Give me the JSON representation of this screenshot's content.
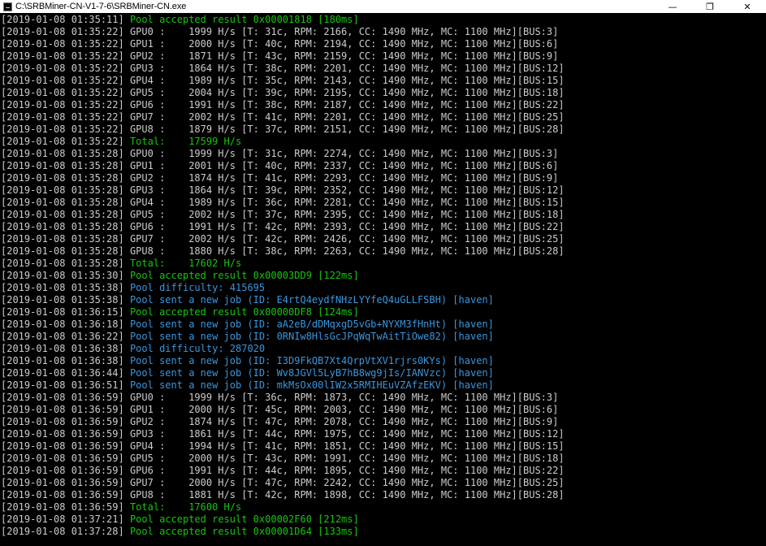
{
  "window": {
    "title": "C:\\SRBMiner-CN-V1-7-6\\SRBMiner-CN.exe",
    "minimize_glyph": "—",
    "restore_glyph": "❐",
    "close_glyph": "✕"
  },
  "colors": {
    "background": "#000000",
    "default_text": "#cccccc",
    "accepted_green": "#16c60c",
    "pool_cyan": "#3a96dd"
  },
  "console_lines": [
    {
      "text": "[2019-01-08 01:35:11] Pool accepted result 0x00001818 [180ms]",
      "style": "accepted"
    },
    {
      "text": "[2019-01-08 01:35:22] GPU0 :    1999 H/s [T: 31c, RPM: 2166, CC: 1490 MHz, MC: 1100 MHz][BUS:3]",
      "style": "normal"
    },
    {
      "text": "[2019-01-08 01:35:22] GPU1 :    2000 H/s [T: 40c, RPM: 2194, CC: 1490 MHz, MC: 1100 MHz][BUS:6]",
      "style": "normal"
    },
    {
      "text": "[2019-01-08 01:35:22] GPU2 :    1871 H/s [T: 43c, RPM: 2159, CC: 1490 MHz, MC: 1100 MHz][BUS:9]",
      "style": "normal"
    },
    {
      "text": "[2019-01-08 01:35:22] GPU3 :    1864 H/s [T: 38c, RPM: 2201, CC: 1490 MHz, MC: 1100 MHz][BUS:12]",
      "style": "normal"
    },
    {
      "text": "[2019-01-08 01:35:22] GPU4 :    1989 H/s [T: 35c, RPM: 2143, CC: 1490 MHz, MC: 1100 MHz][BUS:15]",
      "style": "normal"
    },
    {
      "text": "[2019-01-08 01:35:22] GPU5 :    2004 H/s [T: 39c, RPM: 2195, CC: 1490 MHz, MC: 1100 MHz][BUS:18]",
      "style": "normal"
    },
    {
      "text": "[2019-01-08 01:35:22] GPU6 :    1991 H/s [T: 38c, RPM: 2187, CC: 1490 MHz, MC: 1100 MHz][BUS:22]",
      "style": "normal"
    },
    {
      "text": "[2019-01-08 01:35:22] GPU7 :    2002 H/s [T: 41c, RPM: 2201, CC: 1490 MHz, MC: 1100 MHz][BUS:25]",
      "style": "normal"
    },
    {
      "text": "[2019-01-08 01:35:22] GPU8 :    1879 H/s [T: 37c, RPM: 2151, CC: 1490 MHz, MC: 1100 MHz][BUS:28]",
      "style": "normal"
    },
    {
      "text": "[2019-01-08 01:35:22] Total:    17599 H/s",
      "style": "total"
    },
    {
      "text": "[2019-01-08 01:35:28] GPU0 :    1999 H/s [T: 31c, RPM: 2274, CC: 1490 MHz, MC: 1100 MHz][BUS:3]",
      "style": "normal"
    },
    {
      "text": "[2019-01-08 01:35:28] GPU1 :    2001 H/s [T: 40c, RPM: 2337, CC: 1490 MHz, MC: 1100 MHz][BUS:6]",
      "style": "normal"
    },
    {
      "text": "[2019-01-08 01:35:28] GPU2 :    1874 H/s [T: 41c, RPM: 2293, CC: 1490 MHz, MC: 1100 MHz][BUS:9]",
      "style": "normal"
    },
    {
      "text": "[2019-01-08 01:35:28] GPU3 :    1864 H/s [T: 39c, RPM: 2352, CC: 1490 MHz, MC: 1100 MHz][BUS:12]",
      "style": "normal"
    },
    {
      "text": "[2019-01-08 01:35:28] GPU4 :    1989 H/s [T: 36c, RPM: 2281, CC: 1490 MHz, MC: 1100 MHz][BUS:15]",
      "style": "normal"
    },
    {
      "text": "[2019-01-08 01:35:28] GPU5 :    2002 H/s [T: 37c, RPM: 2395, CC: 1490 MHz, MC: 1100 MHz][BUS:18]",
      "style": "normal"
    },
    {
      "text": "[2019-01-08 01:35:28] GPU6 :    1991 H/s [T: 42c, RPM: 2393, CC: 1490 MHz, MC: 1100 MHz][BUS:22]",
      "style": "normal"
    },
    {
      "text": "[2019-01-08 01:35:28] GPU7 :    2002 H/s [T: 42c, RPM: 2426, CC: 1490 MHz, MC: 1100 MHz][BUS:25]",
      "style": "normal"
    },
    {
      "text": "[2019-01-08 01:35:28] GPU8 :    1880 H/s [T: 38c, RPM: 2263, CC: 1490 MHz, MC: 1100 MHz][BUS:28]",
      "style": "normal"
    },
    {
      "text": "[2019-01-08 01:35:28] Total:    17602 H/s",
      "style": "total"
    },
    {
      "text": "[2019-01-08 01:35:30] Pool accepted result 0x00003DD9 [122ms]",
      "style": "accepted"
    },
    {
      "text": "[2019-01-08 01:35:38] Pool difficulty: 415695",
      "style": "pool"
    },
    {
      "text": "[2019-01-08 01:35:38] Pool sent a new job (ID: E4rtQ4eydfNHzLYYfeQ4uGLLFSBH) [haven]",
      "style": "pool"
    },
    {
      "text": "[2019-01-08 01:36:15] Pool accepted result 0x00000DF8 [124ms]",
      "style": "accepted"
    },
    {
      "text": "[2019-01-08 01:36:18] Pool sent a new job (ID: aA2eB/dDMqxgD5vGb+NYXM3fHnHt) [haven]",
      "style": "pool"
    },
    {
      "text": "[2019-01-08 01:36:22] Pool sent a new job (ID: 0RNIw8HlsGcJPqWqTwAitTiOwe82) [haven]",
      "style": "pool"
    },
    {
      "text": "[2019-01-08 01:36:38] Pool difficulty: 287020",
      "style": "pool"
    },
    {
      "text": "[2019-01-08 01:36:38] Pool sent a new job (ID: I3D9FkQB7Xt4QrpVtXV1rjrs0KYs) [haven]",
      "style": "pool"
    },
    {
      "text": "[2019-01-08 01:36:44] Pool sent a new job (ID: Wv8JGVl5LyB7hB8wg9jIs/IANVzc) [haven]",
      "style": "pool"
    },
    {
      "text": "[2019-01-08 01:36:51] Pool sent a new job (ID: mkMsOx00lIW2x5RMIHEuVZAfzEKV) [haven]",
      "style": "pool"
    },
    {
      "text": "[2019-01-08 01:36:59] GPU0 :    1999 H/s [T: 36c, RPM: 1873, CC: 1490 MHz, MC: 1100 MHz][BUS:3]",
      "style": "normal"
    },
    {
      "text": "[2019-01-08 01:36:59] GPU1 :    2000 H/s [T: 45c, RPM: 2003, CC: 1490 MHz, MC: 1100 MHz][BUS:6]",
      "style": "normal"
    },
    {
      "text": "[2019-01-08 01:36:59] GPU2 :    1874 H/s [T: 47c, RPM: 2078, CC: 1490 MHz, MC: 1100 MHz][BUS:9]",
      "style": "normal"
    },
    {
      "text": "[2019-01-08 01:36:59] GPU3 :    1861 H/s [T: 44c, RPM: 1975, CC: 1490 MHz, MC: 1100 MHz][BUS:12]",
      "style": "normal"
    },
    {
      "text": "[2019-01-08 01:36:59] GPU4 :    1994 H/s [T: 41c, RPM: 1851, CC: 1490 MHz, MC: 1100 MHz][BUS:15]",
      "style": "normal"
    },
    {
      "text": "[2019-01-08 01:36:59] GPU5 :    2000 H/s [T: 43c, RPM: 1991, CC: 1490 MHz, MC: 1100 MHz][BUS:18]",
      "style": "normal"
    },
    {
      "text": "[2019-01-08 01:36:59] GPU6 :    1991 H/s [T: 44c, RPM: 1895, CC: 1490 MHz, MC: 1100 MHz][BUS:22]",
      "style": "normal"
    },
    {
      "text": "[2019-01-08 01:36:59] GPU7 :    2000 H/s [T: 47c, RPM: 2242, CC: 1490 MHz, MC: 1100 MHz][BUS:25]",
      "style": "normal"
    },
    {
      "text": "[2019-01-08 01:36:59] GPU8 :    1881 H/s [T: 42c, RPM: 1898, CC: 1490 MHz, MC: 1100 MHz][BUS:28]",
      "style": "normal"
    },
    {
      "text": "[2019-01-08 01:36:59] Total:    17600 H/s",
      "style": "total"
    },
    {
      "text": "[2019-01-08 01:37:21] Pool accepted result 0x00002F60 [212ms]",
      "style": "accepted"
    },
    {
      "text": "[2019-01-08 01:37:28] Pool accepted result 0x00001D64 [133ms]",
      "style": "accepted"
    }
  ]
}
